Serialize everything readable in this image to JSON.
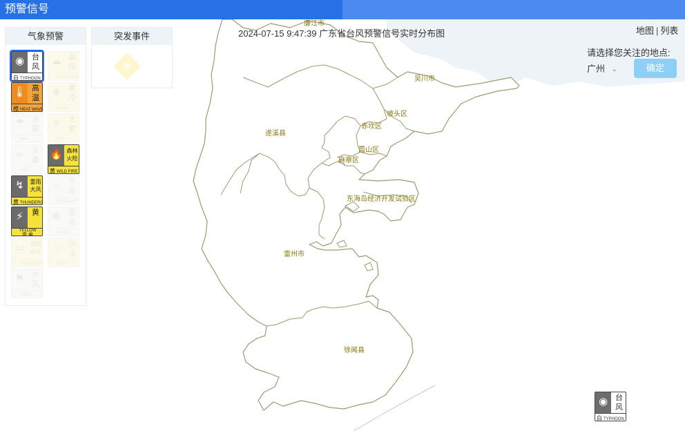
{
  "header": {
    "title": "预警信号"
  },
  "map": {
    "timestamp": "2024-07-15 9:47:39 广东省台风预警信号实时分布图",
    "places": [
      {
        "id": "lianjiang",
        "name": "廉江市"
      },
      {
        "id": "wuchuan",
        "name": "吴川市"
      },
      {
        "id": "potou",
        "name": "坡头区"
      },
      {
        "id": "chikan",
        "name": "赤坎区"
      },
      {
        "id": "suixi",
        "name": "遂溪县"
      },
      {
        "id": "xiashan",
        "name": "霞山区"
      },
      {
        "id": "mazhang",
        "name": "麻章区"
      },
      {
        "id": "donghai",
        "name": "东海岛经济开发试验区"
      },
      {
        "id": "leizhou",
        "name": "雷州市"
      },
      {
        "id": "xuwen",
        "name": "徐闻县"
      }
    ]
  },
  "controls": {
    "view_map": "地图",
    "view_separator": "|",
    "view_list": "列表",
    "select_prompt": "请选择您关注的地点:",
    "selected_city": "广州",
    "caret": "⌄",
    "confirm_label": "确定"
  },
  "panels": {
    "weather_title": "气象预警",
    "emergency_title": "突发事件"
  },
  "warnings": [
    {
      "id": "typhoon",
      "name_line1": "台",
      "name_line2": "风",
      "level": "白",
      "code": "TYPHOON",
      "glyph": "◉",
      "active": true,
      "selected": true,
      "bg": "#ffffff",
      "left_color": "#6d6d6d",
      "text_color": "#333333"
    },
    {
      "id": "rainstorm",
      "name_line1": "暴",
      "name_line2": "雨",
      "level": "",
      "code": "RAINSTORM",
      "glyph": "☁",
      "active": false,
      "bg": "#f6f3c4",
      "left_color": "#f6f3c4",
      "text_color": "#c9c28a"
    },
    {
      "id": "heat",
      "name_line1": "高",
      "name_line2": "温",
      "level": "橙",
      "code": "HEAT WAVE",
      "glyph": "🌡",
      "active": true,
      "bg": "#f3a53a",
      "left_color": "#f08b1d",
      "text_color": "#222222"
    },
    {
      "id": "cold",
      "name_line1": "寒",
      "name_line2": "冷",
      "level": "",
      "code": "COLD",
      "glyph": "❄",
      "active": false,
      "bg": "#f6f3c4",
      "left_color": "#f6f3c4",
      "text_color": "#c9c28a"
    },
    {
      "id": "hail",
      "name_line1": "冰",
      "name_line2": "雹",
      "level": "",
      "code": "HAIL",
      "glyph": "☂",
      "active": false,
      "bg": "#f0eee6",
      "left_color": "#f0eee6",
      "text_color": "#c8c4b4"
    },
    {
      "id": "fog",
      "name_line1": "大",
      "name_line2": "雾",
      "level": "",
      "code": "FOG",
      "glyph": "≡",
      "active": false,
      "bg": "#f6f3c4",
      "left_color": "#f6f3c4",
      "text_color": "#c9c28a"
    },
    {
      "id": "haze",
      "name_line1": "灰",
      "name_line2": "霾",
      "level": "",
      "code": "HAZE",
      "glyph": "∞",
      "active": false,
      "bg": "#f0eee6",
      "left_color": "#f0eee6",
      "text_color": "#c8c4b4"
    },
    {
      "id": "fire",
      "name_line1": "森林",
      "name_line2": "火险",
      "level": "黄",
      "code": "WILD FIRE",
      "glyph": "🔥",
      "active": true,
      "bg": "#f5e23a",
      "left_color": "#6b6b6b",
      "text_color": "#222222"
    },
    {
      "id": "thunder-gust",
      "name_line1": "雷雨",
      "name_line2": "大风",
      "level": "黄",
      "code": "THUNDERGUST",
      "glyph": "↯",
      "active": true,
      "bg": "#f5e23a",
      "left_color": "#6b6b6b",
      "text_color": "#222222"
    },
    {
      "id": "drought",
      "name_line1": "干",
      "name_line2": "旱",
      "level": "",
      "code": "DROUGHT",
      "glyph": "☼",
      "active": false,
      "bg": "#f0eee6",
      "left_color": "#f0eee6",
      "text_color": "#c8c4b4"
    },
    {
      "id": "lightning",
      "name_line1": "黄",
      "name_line2": "",
      "level": "YELLOW",
      "code": "雷 电",
      "glyph": "⚡",
      "active": true,
      "bg": "#f5e23a",
      "left_color": "#6b6b6b",
      "text_color": "#222222"
    },
    {
      "id": "frost",
      "name_line1": "霜",
      "name_line2": "冻",
      "level": "",
      "code": "FROST",
      "glyph": "✻",
      "active": false,
      "bg": "#f0eee6",
      "left_color": "#f0eee6",
      "text_color": "#c8c4b4"
    },
    {
      "id": "road-ice",
      "name_line1": "道路",
      "name_line2": "结冰",
      "level": "",
      "code": "ROAD ICING",
      "glyph": "▭",
      "active": false,
      "bg": "#f6f3c4",
      "left_color": "#f6f3c4",
      "text_color": "#c9c28a"
    },
    {
      "id": "dust",
      "name_line1": "沙",
      "name_line2": "尘",
      "level": "",
      "code": "DUST",
      "glyph": "∴",
      "active": false,
      "bg": "#f6f3c4",
      "left_color": "#f6f3c4",
      "text_color": "#c9c28a"
    },
    {
      "id": "gale",
      "name_line1": "大",
      "name_line2": "风",
      "level": "",
      "code": "GALE",
      "glyph": "⚑",
      "active": false,
      "bg": "#f0eee6",
      "left_color": "#f0eee6",
      "text_color": "#c8c4b4"
    }
  ],
  "legend_icon": {
    "name_line1": "台",
    "name_line2": "风",
    "level": "白",
    "code": "TYPHOON",
    "glyph": "◉"
  },
  "colors": {
    "header_dark": "#2671e5",
    "header_light": "#4d8af0",
    "boundary": "#9a9a72",
    "sea_tint": "#eef3f8",
    "label": "#8a7a12"
  }
}
